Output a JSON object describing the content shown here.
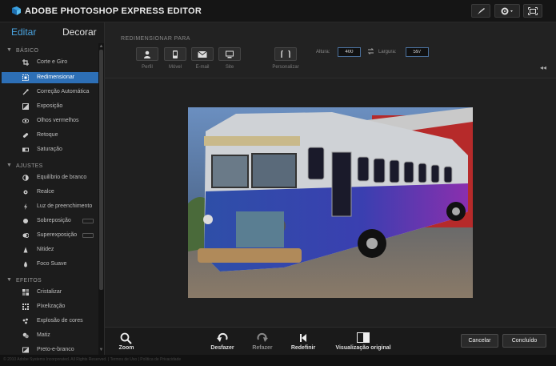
{
  "app": {
    "title": "ADOBE PHOTOSHOP EXPRESS EDITOR"
  },
  "modes": {
    "edit": "Editar",
    "decorate": "Decorar"
  },
  "sections": [
    {
      "title": "BÁSICO",
      "items": [
        {
          "label": "Corte e Giro",
          "icon": "crop-icon"
        },
        {
          "label": "Redimensionar",
          "icon": "resize-icon",
          "active": true
        },
        {
          "label": "Correção Automática",
          "icon": "magic-wand-icon"
        },
        {
          "label": "Exposição",
          "icon": "exposure-icon"
        },
        {
          "label": "Olhos vermelhos",
          "icon": "eye-icon"
        },
        {
          "label": "Retoque",
          "icon": "bandage-icon"
        },
        {
          "label": "Saturação",
          "icon": "saturation-icon"
        }
      ]
    },
    {
      "title": "AJUSTES",
      "items": [
        {
          "label": "Equilíbrio de branco",
          "icon": "white-balance-icon"
        },
        {
          "label": "Realce",
          "icon": "highlight-icon"
        },
        {
          "label": "Luz de preenchimento",
          "icon": "fill-light-icon"
        },
        {
          "label": "Sobreposição",
          "icon": "overlay-icon",
          "toggle": true
        },
        {
          "label": "Superexposição",
          "icon": "overexposure-icon",
          "toggle": true
        },
        {
          "label": "Nitidez",
          "icon": "sharpen-icon"
        },
        {
          "label": "Foco Suave",
          "icon": "soft-focus-icon"
        }
      ]
    },
    {
      "title": "EFEITOS",
      "items": [
        {
          "label": "Cristalizar",
          "icon": "crystallize-icon"
        },
        {
          "label": "Pixelização",
          "icon": "pixelate-icon"
        },
        {
          "label": "Explosão de cores",
          "icon": "color-burst-icon"
        },
        {
          "label": "Matiz",
          "icon": "hue-icon"
        },
        {
          "label": "Preto-e-branco",
          "icon": "black-white-icon"
        }
      ]
    }
  ],
  "resize": {
    "title": "REDIMENSIONAR PARA",
    "presets": [
      {
        "label": "Perfil",
        "icon": "profile-icon"
      },
      {
        "label": "Móvel",
        "icon": "mobile-icon"
      },
      {
        "label": "E-mail",
        "icon": "email-icon"
      },
      {
        "label": "Site",
        "icon": "website-icon"
      },
      {
        "label": "Personalizar",
        "icon": "custom-icon"
      }
    ],
    "height_label": "Altura:",
    "height_value": "400",
    "width_label": "Largura:",
    "width_value": "597"
  },
  "bottom": {
    "zoom": "Zoom",
    "undo": "Desfazer",
    "redo": "Refazer",
    "reset": "Redefinir",
    "original": "Visualização original",
    "cancel": "Cancelar",
    "done": "Concluído"
  },
  "footer": {
    "text": "© 2010 Adobe Systems Incorporated. All Rights Reserved. | Termos de Uso | Política de Privacidade"
  },
  "colors": {
    "accent": "#2d6fb6",
    "edit_tab": "#4aa3df"
  }
}
